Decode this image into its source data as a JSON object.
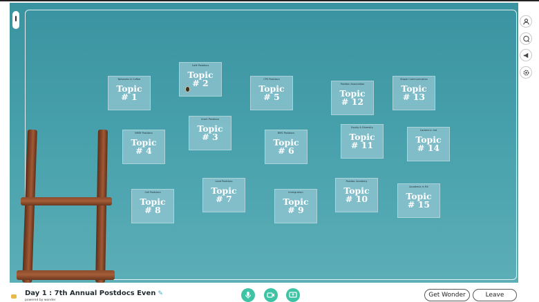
{
  "topics": [
    {
      "name": "Networks & Coffee",
      "label": "Topic # 1"
    },
    {
      "name": "Café Postdocs",
      "label": "Topic # 2"
    },
    {
      "name": "Grant Postdocs",
      "label": "Topic # 3"
    },
    {
      "name": "NIMH Postdocs",
      "label": "Topic # 4"
    },
    {
      "name": "CPS Postdocs",
      "label": "Topic # 5"
    },
    {
      "name": "BMS Postdocs",
      "label": "Topic # 6"
    },
    {
      "name": "Lead Postdocs",
      "label": "Topic # 7"
    },
    {
      "name": "Cell Postdocs",
      "label": "Topic # 8"
    },
    {
      "name": "Immigration",
      "label": "Topic # 9"
    },
    {
      "name": "Postdoc Academy",
      "label": "Topic # 10"
    },
    {
      "name": "Equity & Diversity",
      "label": "Topic # 11"
    },
    {
      "name": "Postdoc Association",
      "label": "Topic # 12"
    },
    {
      "name": "Staple Communication",
      "label": "Topic # 13"
    },
    {
      "name": "Careers in Ind",
      "label": "Topic # 14"
    },
    {
      "name": "Academia in RX",
      "label": "Topic # 15"
    }
  ],
  "toolbar": {
    "icons": [
      "people-icon",
      "chat-icon",
      "megaphone-icon",
      "settings-icon"
    ]
  },
  "bottom_bar": {
    "event_title": "Day 1 : 7th Annual Postdocs Even",
    "edit_mark": "✎",
    "powered_by": "powered by wonder",
    "get_wonder_label": "Get Wonder",
    "leave_label": "Leave"
  },
  "colors": {
    "background": "#46a0ab",
    "media_button": "#3ec3a5",
    "topic_box": "#96c8d2"
  }
}
